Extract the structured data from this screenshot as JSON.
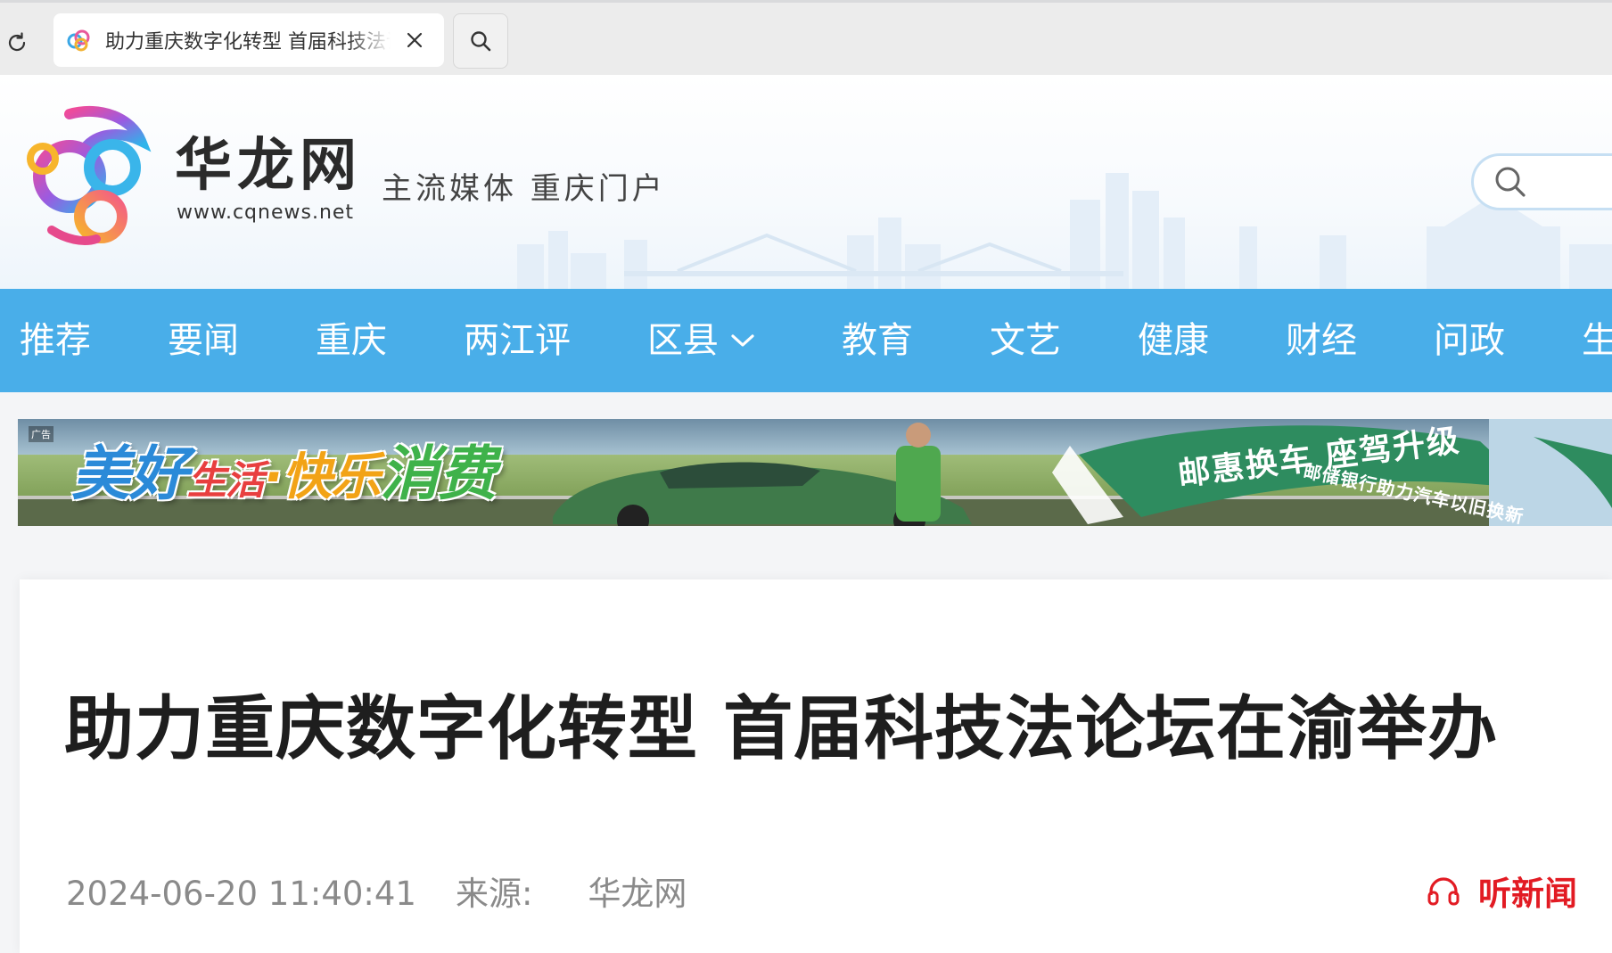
{
  "browser": {
    "tab_title": "助力重庆数字化转型 首届科技法论坛在渝举办"
  },
  "site": {
    "name": "华龙网",
    "url": "www.cqnews.net",
    "slogan": "主流媒体  重庆门户"
  },
  "nav": {
    "items": [
      {
        "label": "推荐"
      },
      {
        "label": "要闻"
      },
      {
        "label": "重庆"
      },
      {
        "label": "两江评"
      },
      {
        "label": "区县"
      },
      {
        "label": "教育"
      },
      {
        "label": "文艺"
      },
      {
        "label": "健康"
      },
      {
        "label": "财经"
      },
      {
        "label": "问政"
      },
      {
        "label": "生"
      }
    ]
  },
  "ad": {
    "tag": "广告",
    "slogan_1": "美好",
    "slogan_2": "生活",
    "slogan_3": "·快乐",
    "slogan_4": "消费",
    "ribbon_title": "邮惠换车 座驾升级",
    "ribbon_subtitle": "邮储银行助力汽车以旧换新",
    "colors": {
      "sky": "#9fc3d9",
      "field": "#7da25a",
      "ribbon": "#2e8c5f"
    }
  },
  "article": {
    "title": "助力重庆数字化转型 首届科技法论坛在渝举办",
    "datetime": "2024-06-20 11:40:41",
    "source_label": "来源:",
    "source": "华龙网",
    "listen_label": "听新闻"
  },
  "colors": {
    "nav_bg": "#49aee9",
    "listen_red": "#e21b23",
    "title_text": "#1e1e1e",
    "meta_text": "#8a8a8a"
  }
}
